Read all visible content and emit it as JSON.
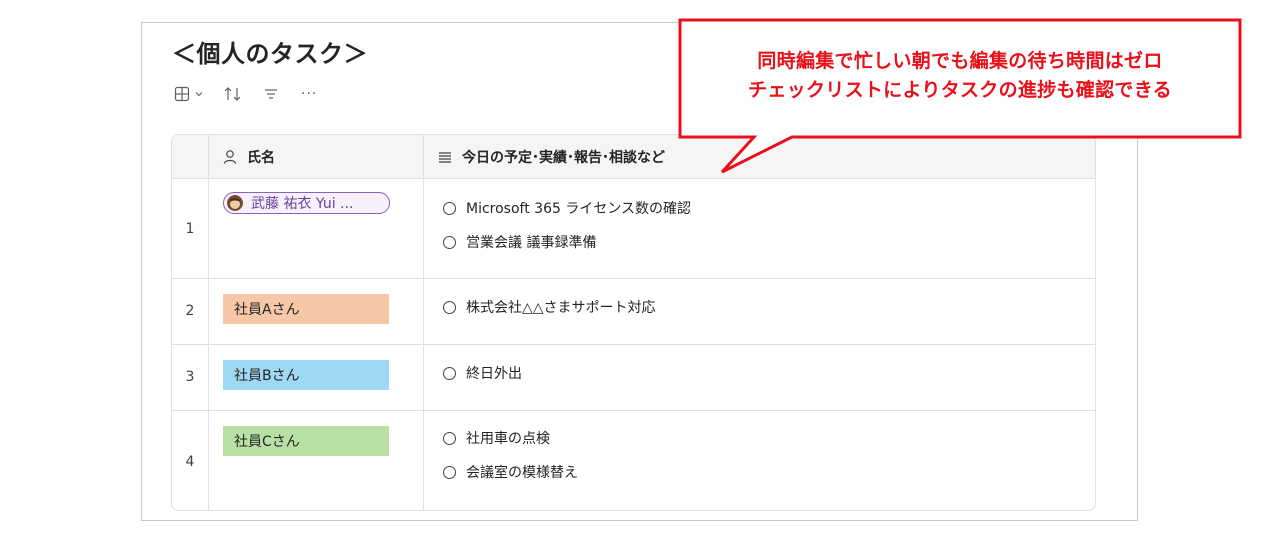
{
  "page": {
    "title": "＜個人のタスク＞"
  },
  "toolbar": {
    "view_icon": "grid-view-icon",
    "sort_icon": "sort-icon",
    "filter_icon": "filter-icon",
    "more_label": "···"
  },
  "table": {
    "columns": [
      {
        "icon": "person-icon",
        "label": "氏名"
      },
      {
        "icon": "text-lines-icon",
        "label": "今日の予定･実績･報告･相談など"
      }
    ],
    "rows": [
      {
        "num": "1",
        "name": "武藤 祐衣 Yui ...",
        "name_type": "person",
        "tasks": [
          "Microsoft 365 ライセンス数の確認",
          "営業会議 議事録準備"
        ]
      },
      {
        "num": "2",
        "name": "社員Aさん",
        "name_color": "#f7c8a8",
        "tasks": [
          "株式会社△△さまサポート対応"
        ]
      },
      {
        "num": "3",
        "name": "社員Bさん",
        "name_color": "#9fd8f3",
        "tasks": [
          "終日外出"
        ]
      },
      {
        "num": "4",
        "name": "社員Cさん",
        "name_color": "#b8e0a4",
        "tasks": [
          "社用車の点検",
          "会議室の模様替え"
        ]
      }
    ]
  },
  "callout": {
    "line1": "同時編集で忙しい朝でも編集の待ち時間はゼロ",
    "line2": "チェックリストによりタスクの進捗も確認できる",
    "color": "#e8101a"
  }
}
